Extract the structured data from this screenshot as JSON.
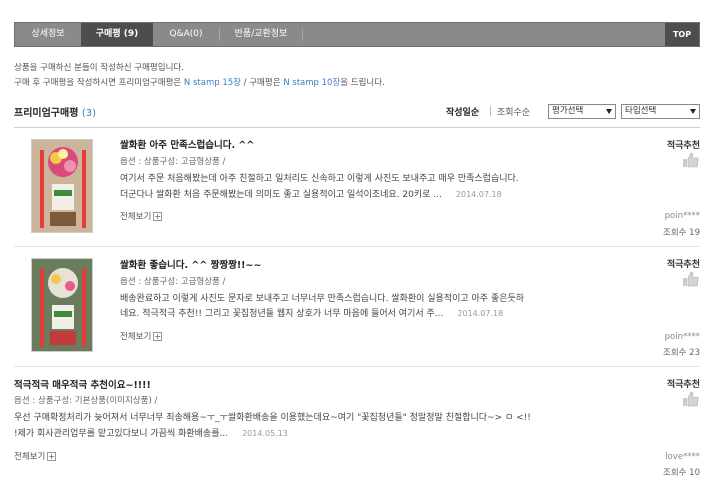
{
  "tabs": [
    {
      "label": "상세정보"
    },
    {
      "label": "구매평 (9)"
    },
    {
      "label": "Q&A(0)"
    },
    {
      "label": "반품/교환정보"
    }
  ],
  "top_label": "TOP",
  "intro": {
    "line1": "상품을 구매하신 분들이 작성하신 구매평입니다.",
    "line2_a": "구매 후 구매평을 작성하시면 프리미엄구매평은 ",
    "line2_b": "N stamp 15장",
    "line2_c": " / 구매평은 ",
    "line2_d": "N stamp 10장",
    "line2_e": "을 드립니다."
  },
  "premium": {
    "title": "프리미엄구매평",
    "count": "(3)"
  },
  "sort": {
    "recent": "작성일순",
    "views": "조회수순"
  },
  "filters": {
    "rating": "평가선택",
    "type": "타입선택"
  },
  "reviews": [
    {
      "title": "쌀화환 아주 만족스럽습니다. ^^",
      "option": "옵션 : 상품구성: 고급형상품 /",
      "line1": "여기서 주문 처음해봤는데 아주 친절하고 일처리도 신속하고 이렇게 사진도 보내주고 매우 만족스럽습니다.",
      "line2": "더군다나 쌀화환 처음 주문해봤는데 의미도 좋고 실용적이고 일석이조네요. 20키로 ...",
      "date": "2014.07.18",
      "more": "전체보기",
      "recommend": "적극추천",
      "user": "poin****",
      "views": "조회수 19"
    },
    {
      "title": "쌀화환 좋습니다. ^^ 짱짱짱!!~~",
      "option": "옵션 : 상품구성: 고급형상품 /",
      "line1": "배송완료하고 이렇게 사진도 문자로 보내주고 너무너무 만족스럽습니다. 쌀화환이 실용적이고 아주 좋은듯하",
      "line2": "네요. 적극적극 추천!! 그리고 꽃집청년들 웹지 상호가 너무 마음에 들어서 여기서 주...",
      "date": "2014.07.18",
      "more": "전체보기",
      "recommend": "적극추천",
      "user": "poin****",
      "views": "조회수 23"
    },
    {
      "title": "적극적극 매우적극 추천이요~!!!!",
      "option": "옵션 : 상품구성: 기본상품(이미지상품) /",
      "line1": "우선 구매확정처리가 늦어져서 너무너무 죄송해용~ㅜ_ㅜ쌀화환배송을 이용했는데요~여기 \"꽃집청년들\" 정말정말 친절합니다~> ㅁ <!!",
      "line2": "!제가 회사관리업무를 맡고있다보니 가끔씩 화환배송를...",
      "date": "2014.05.13",
      "more": "전체보기",
      "recommend": "적극추천",
      "user": "love****",
      "views": "조회수 10"
    }
  ],
  "colors": {
    "tab_bg": "#8a8a8a",
    "tab_active": "#4d4d4d",
    "accent": "#3b7bbf"
  }
}
